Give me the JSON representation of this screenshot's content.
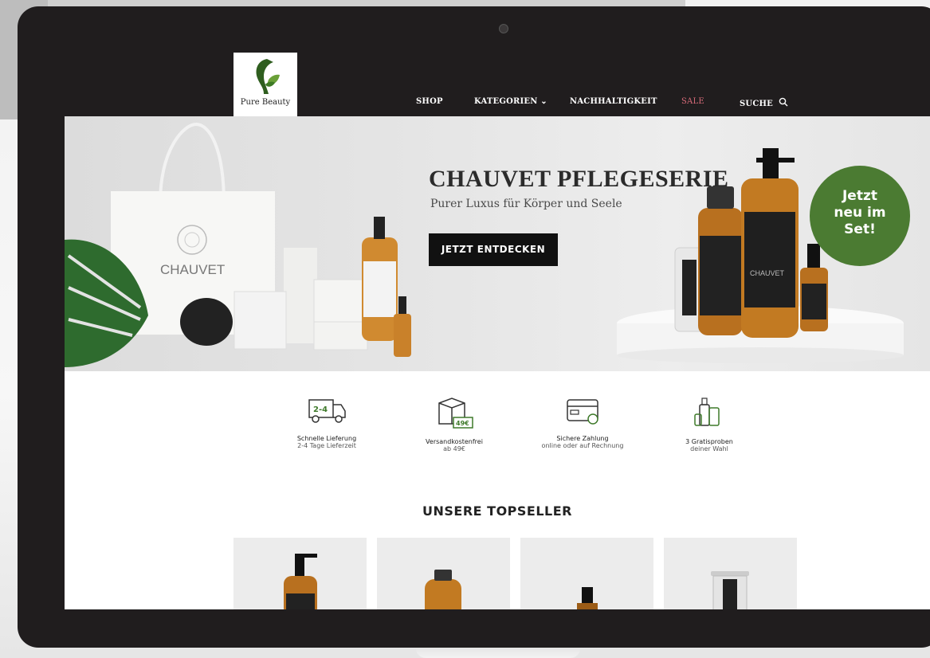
{
  "brand": {
    "logo_text": "Pure Beauty"
  },
  "nav": {
    "shop": "SHOP",
    "kategorien": "KATEGORIEN",
    "nachhaltigkeit": "NACHHALTIGKEIT",
    "sale": "SALE",
    "suche": "SUCHE",
    "sale_color": "#d86b79"
  },
  "hero": {
    "title": "CHAUVET PFLEGESERIE",
    "subtitle": "Purer Luxus für Körper und Seele",
    "button": "JETZT ENTDECKEN",
    "badge_lines": [
      "Jetzt",
      "neu im",
      "Set!"
    ],
    "brand_on_bag": "CHAUVET",
    "brand_on_products": "CHAUVET",
    "badge_color": "#4b7b32"
  },
  "features": [
    {
      "icon": "delivery-truck-icon",
      "title": "Schnelle Lieferung",
      "sub": "2-4 Tage Lieferzeit",
      "icon_label": "2-4"
    },
    {
      "icon": "package-box-icon",
      "title": "Versandkostenfrei",
      "sub": "ab 49€",
      "icon_label": "49€"
    },
    {
      "icon": "credit-card-icon",
      "title": "Sichere Zahlung",
      "sub": "online oder auf Rechnung"
    },
    {
      "icon": "sample-bottles-icon",
      "title": "3 Gratisproben",
      "sub": "deiner Wahl"
    }
  ],
  "topseller": {
    "heading": "UNSERE TOPSELLER"
  }
}
